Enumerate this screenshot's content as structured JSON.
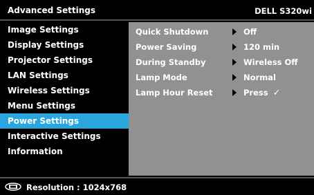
{
  "header": {
    "title": "Advanced Settings",
    "model": "DELL S320wi"
  },
  "sidebar": {
    "items": [
      {
        "label": "Image Settings"
      },
      {
        "label": "Display Settings"
      },
      {
        "label": "Projector Settings"
      },
      {
        "label": "LAN Settings"
      },
      {
        "label": "Wireless Settings"
      },
      {
        "label": "Menu Settings"
      },
      {
        "label": "Power Settings",
        "selected": true
      },
      {
        "label": "Interactive Settings"
      },
      {
        "label": "Information"
      }
    ]
  },
  "power_settings": {
    "rows": [
      {
        "label": "Quick Shutdown",
        "value": "Off"
      },
      {
        "label": "Power Saving",
        "value": "120 min"
      },
      {
        "label": "During Standby",
        "value": "Wireless Off"
      },
      {
        "label": "Lamp Mode",
        "value": "Normal"
      },
      {
        "label": "Lamp Hour Reset",
        "value": "Press",
        "check": "✓"
      }
    ]
  },
  "status": {
    "icon": "input-source-icon",
    "text": "Resolution : 1024x768"
  },
  "colors": {
    "selected": "#2aa5dd",
    "panel": "#919191",
    "background": "#000000"
  }
}
